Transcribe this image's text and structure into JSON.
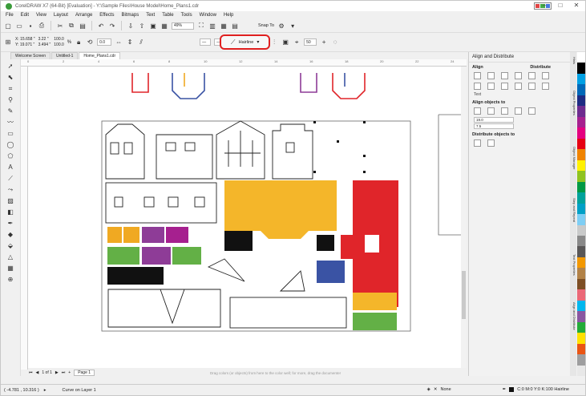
{
  "window": {
    "title": "CorelDRAW X7 (64-Bit) [Evaluation] - Y:\\Sample Files\\House Model\\Home_Plans1.cdr",
    "controls": [
      "‒",
      "□",
      "✕"
    ]
  },
  "menu": [
    "File",
    "Edit",
    "View",
    "Layout",
    "Arrange",
    "Effects",
    "Bitmaps",
    "Text",
    "Table",
    "Tools",
    "Window",
    "Help"
  ],
  "toolbar": {
    "zoom": "49%",
    "snap_to": "Snap To",
    "x": "X: 15.658 \"",
    "y": "Y: 19.071 \"",
    "w": "3.22 \"",
    "h": "3.494 \"",
    "scale_w": "100.0",
    "scale_h": "100.0",
    "pct": "%",
    "angle": "0.0",
    "outline": "Hairline",
    "nudge": "50"
  },
  "tabs": [
    "Welcome Screen",
    "Untitled-1",
    "Home_Plans1.cdr"
  ],
  "ruler_ticks": [
    "0",
    "2",
    "4",
    "6",
    "8",
    "10",
    "12",
    "14",
    "16",
    "18",
    "20",
    "22",
    "24"
  ],
  "docker": {
    "title": "Align and Distribute",
    "align_label": "Align",
    "distribute_label": "Distribute",
    "text_label": "Text",
    "align_to": "Align objects to",
    "field1": "19.0",
    "field2": "7.5",
    "distribute_to": "Distribute objects to"
  },
  "side_tabs": [
    "Hints",
    "Object Properties",
    "Object Manager",
    "Step and Repeat",
    "Text Properties",
    "Align and Distribute"
  ],
  "palette": [
    "#ffffff",
    "#000000",
    "#00a0e4",
    "#0068b8",
    "#1d2b83",
    "#6d2b8f",
    "#a6208f",
    "#e4007f",
    "#e60012",
    "#f08300",
    "#fff100",
    "#8fc31f",
    "#009944",
    "#00a29a",
    "#00a0c6",
    "#7ecef4",
    "#c9caca",
    "#898989",
    "#595757",
    "#f39800",
    "#b28247",
    "#7d4e24",
    "#eb6877",
    "#00b7ee",
    "#8957a1",
    "#22ac38",
    "#ffe100",
    "#ea5514",
    "#9e9e9f",
    "#e8e8e8"
  ],
  "page": {
    "nav": "1 of 1",
    "page_tab": "Page 1",
    "hint": "Drag colors (or objects) from here to the color well; for more, drag the documenter"
  },
  "status": {
    "coords": "( -4.781 , 10.316 )",
    "layer": "Curve on Layer 1",
    "fill_none": "None",
    "outline_info": "C:0 M:0 Y:0 K:100  Hairline"
  },
  "colors": {
    "orange": "#f0a922",
    "red": "#e0252a",
    "purple": "#8e3c97",
    "green": "#63b046",
    "yellow": "#f4b62a",
    "blue": "#3a53a4",
    "black": "#111111",
    "highlight": "#e02020"
  }
}
